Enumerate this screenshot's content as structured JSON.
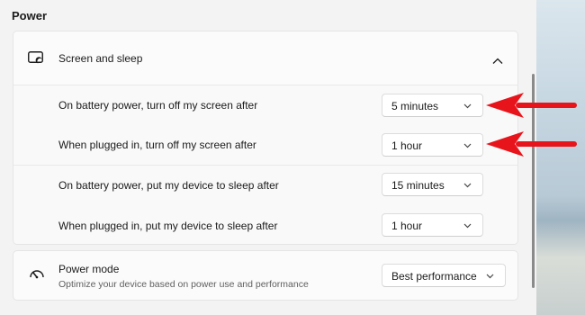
{
  "section": {
    "title": "Power"
  },
  "screen_sleep": {
    "header_label": "Screen and sleep",
    "expanded": true,
    "rows": [
      {
        "label": "On battery power, turn off my screen after",
        "value": "5 minutes"
      },
      {
        "label": "When plugged in, turn off my screen after",
        "value": "1 hour"
      },
      {
        "label": "On battery power, put my device to sleep after",
        "value": "15 minutes"
      },
      {
        "label": "When plugged in, put my device to sleep after",
        "value": "1 hour"
      }
    ]
  },
  "power_mode": {
    "label": "Power mode",
    "description": "Optimize your device based on power use and performance",
    "value": "Best performance"
  },
  "colors": {
    "annotation_arrow": "#e8141b",
    "page_bg": "#f3f3f3",
    "card_bg": "#fbfbfb"
  },
  "icons": [
    "screen-sleep-icon",
    "chevron-up-icon",
    "chevron-down-icon",
    "power-mode-gauge-icon",
    "red-arrow-annotation"
  ]
}
